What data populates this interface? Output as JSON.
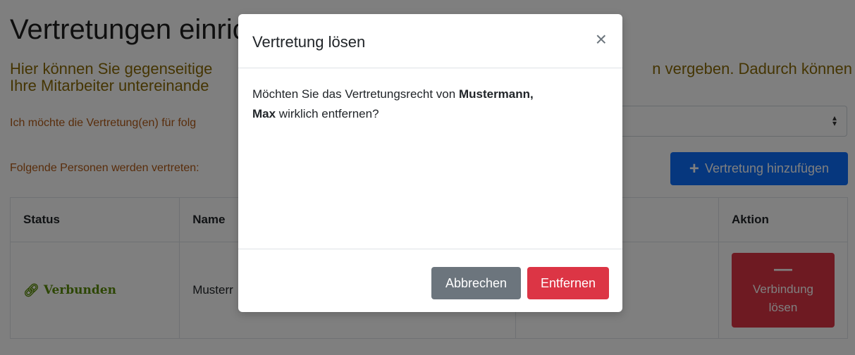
{
  "page": {
    "title": "Vertretungen einrichten",
    "lead_left_1": "Hier können Sie gegenseitige",
    "lead_right_1": "n vergeben. Dadurch können",
    "lead_left_2": "Ihre Mitarbeiter untereinande",
    "select_label": "Ich möchte die Vertretung(en) für folg",
    "list_label": "Folgende Personen werden vertreten:",
    "add_button": "Vertretung hinzufügen"
  },
  "table": {
    "headers": [
      "Status",
      "Name",
      "",
      "Aktion"
    ],
    "rows": [
      {
        "status": "Verbunden",
        "name": "Musterr",
        "col3": "",
        "action_line1": "Verbindung",
        "action_line2": "lösen"
      }
    ]
  },
  "modal": {
    "title": "Vertretung lösen",
    "close_symbol": "×",
    "body_prefix": "Möchten Sie das Vertretungsrecht von ",
    "body_name_1": "Mustermann,",
    "body_name_2": "Max",
    "body_suffix": " wirklich entfernen?",
    "cancel_label": "Abbrechen",
    "confirm_label": "Entfernen"
  },
  "icons": {
    "add": "plus-icon",
    "status": "link-icon",
    "unlink": "minus-icon",
    "select_caret": "sort-caret-icon"
  },
  "colors": {
    "primary": "#0d6efd",
    "danger": "#dc3545",
    "secondary": "#6c757d",
    "success": "#5a8d08",
    "lead_text": "#8a6a06",
    "label_text": "#b35a17"
  }
}
